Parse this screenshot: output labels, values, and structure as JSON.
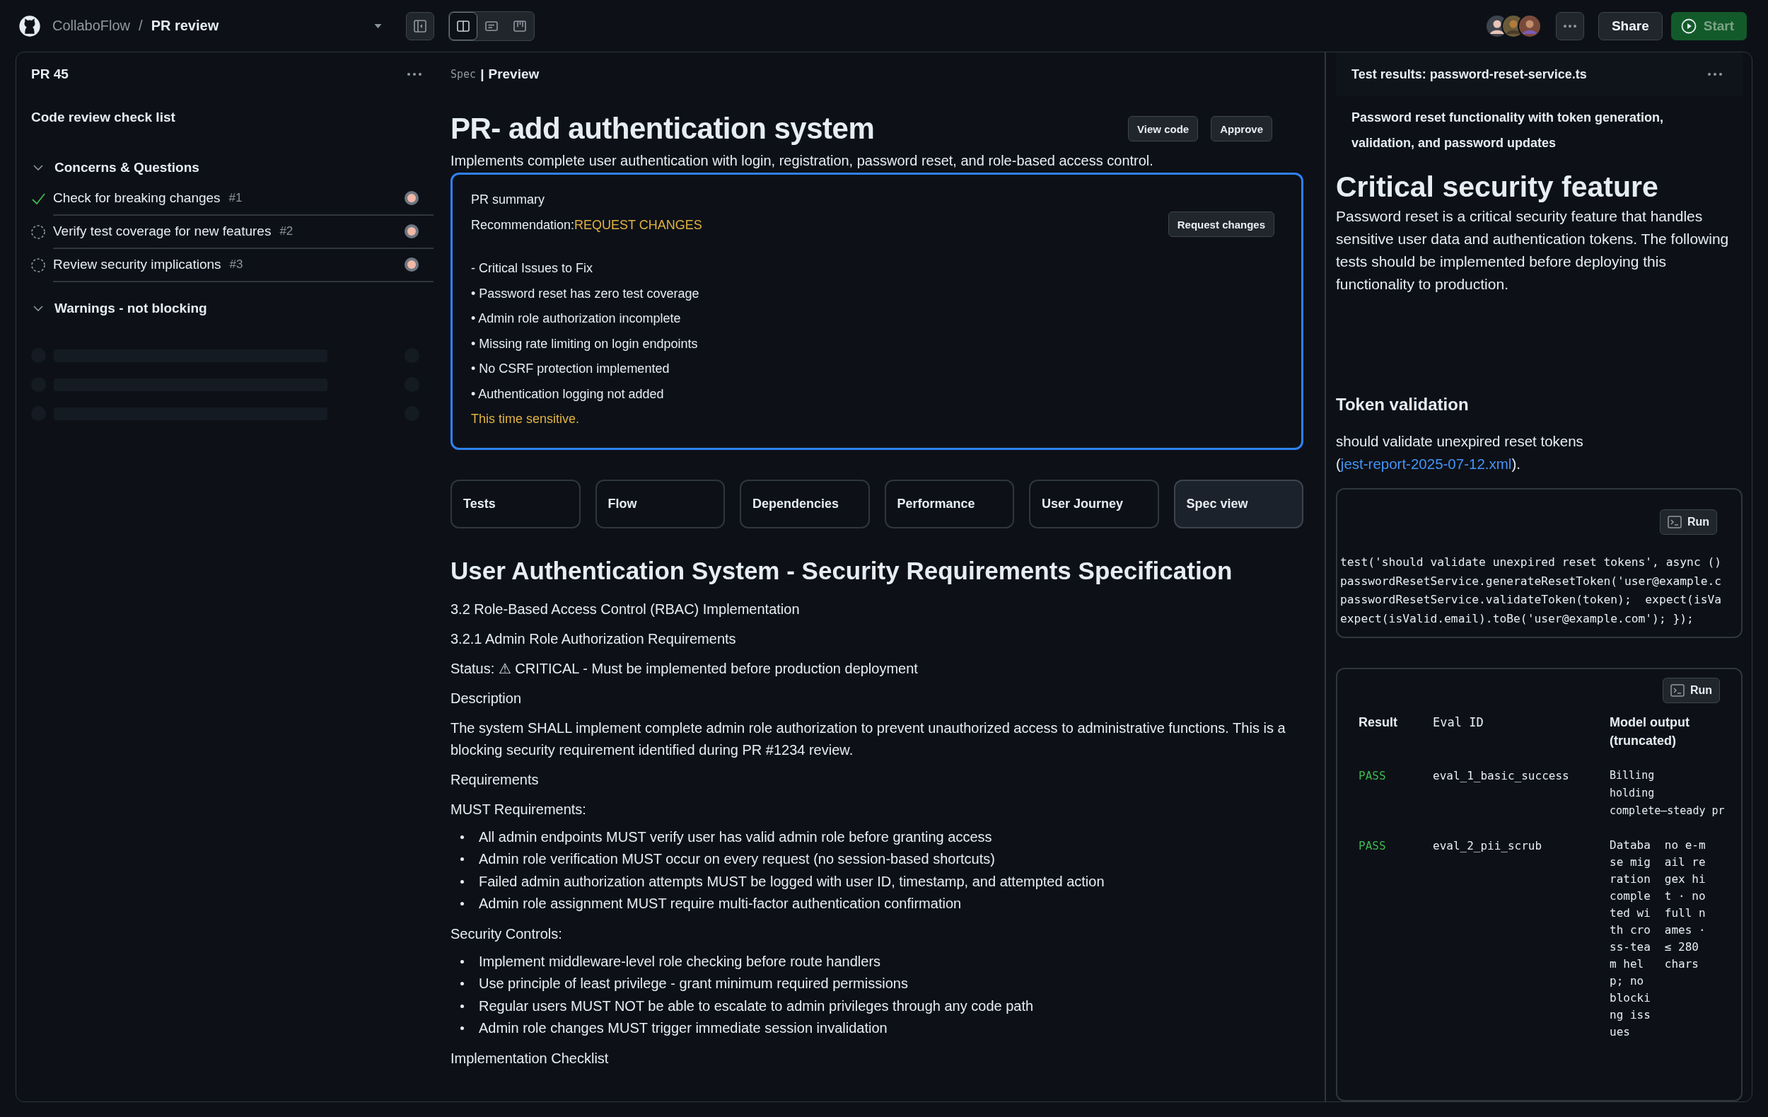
{
  "header": {
    "app": "CollaboFlow",
    "separator": "/",
    "page": "PR review",
    "view_buttons": [
      {
        "selected": true
      },
      {
        "selected": false
      },
      {
        "selected": false
      }
    ],
    "share": "Share",
    "start": "Start"
  },
  "left_panel": {
    "title": "PR 45",
    "heading": "Code review check list",
    "groups": [
      {
        "title": "Concerns & Questions",
        "expanded": true,
        "items": [
          {
            "label": "Check for breaking changes",
            "number": "#1",
            "checked": true
          },
          {
            "label": "Verify test coverage for new features",
            "number": "#2",
            "checked": false
          },
          {
            "label": "Review security implications",
            "number": "#3",
            "checked": false
          }
        ]
      },
      {
        "title": "Warnings - not blocking",
        "expanded": true
      }
    ]
  },
  "preview": {
    "tabs": [
      {
        "label": "Spec",
        "selected": false
      },
      {
        "label": "Preview",
        "selected": true
      }
    ],
    "tab_separator": "|",
    "title": "PR- add authentication system",
    "buttons": [
      "View code",
      "Approve"
    ],
    "description": "Implements complete user authentication with login, registration, password reset, and role-based access control.",
    "summary": {
      "title": "PR summary",
      "recommendation_label": "Recommendation:",
      "recommendation": "REQUEST CHANGES",
      "button": "Request changes",
      "issues_heading": "-  Critical Issues to Fix",
      "issues": [
        "• Password reset has zero test coverage",
        "• Admin role authorization incomplete",
        "• Missing rate limiting on login endpoints",
        "• No CSRF protection implemented",
        "• Authentication logging not added"
      ],
      "note": "This time sensitive."
    },
    "nav_cards": [
      {
        "label": "Tests",
        "selected": false
      },
      {
        "label": "Flow",
        "selected": false
      },
      {
        "label": "Dependencies",
        "selected": false
      },
      {
        "label": "Performance",
        "selected": false
      },
      {
        "label": "User Journey",
        "selected": false
      },
      {
        "label": "Spec view",
        "selected": true
      }
    ],
    "spec": {
      "title": "User Authentication System - Security Requirements Specification",
      "blocks": [
        {
          "kind": "p",
          "text": "3.2 Role-Based Access Control (RBAC) Implementation"
        },
        {
          "kind": "p",
          "text": "3.2.1 Admin Role Authorization Requirements"
        },
        {
          "kind": "p",
          "text": "Status: ⚠ CRITICAL - Must be implemented before production deployment"
        },
        {
          "kind": "p",
          "text": "Description"
        },
        {
          "kind": "p",
          "text": "The system SHALL implement complete admin role authorization to prevent unauthorized access to administrative functions. This is a blocking security requirement identified during PR #1234 review."
        },
        {
          "kind": "p",
          "text": "Requirements"
        },
        {
          "kind": "p",
          "text": "MUST Requirements:"
        },
        {
          "kind": "list",
          "items": [
            "All admin endpoints MUST verify user has valid admin role before granting access",
            "Admin role verification MUST occur on every request (no session-based shortcuts)",
            "Failed admin authorization attempts MUST be logged with user ID, timestamp, and attempted action",
            "Admin role assignment MUST require multi-factor authentication confirmation"
          ]
        },
        {
          "kind": "p",
          "text": "Security Controls:"
        },
        {
          "kind": "list",
          "items": [
            "Implement middleware-level role checking before route handlers",
            "Use principle of least privilege - grant minimum required permissions",
            "Regular users MUST NOT be able to escalate to admin privileges through any code path",
            "Admin role changes MUST trigger immediate session invalidation"
          ]
        },
        {
          "kind": "p",
          "text": "Implementation Checklist"
        }
      ]
    }
  },
  "test_panel": {
    "title": "Test results: password-reset-service.ts",
    "subtitle": "Password reset functionality with token generation, validation, and password updates",
    "heading": "Critical security feature",
    "body": "Password reset is a critical security feature that handles sensitive user data and authentication tokens. The following tests should be implemented before deploying this functionality to production.",
    "section_title": "Token validation",
    "test_text": "should validate unexpired reset tokens (",
    "link": "jest-report-2025-07-12.xml",
    "test_text_end": ").",
    "run_button": "Run",
    "code": [
      "test('should validate unexpired reset tokens', async ()",
      "passwordResetService.generateResetToken('user@example.c",
      "passwordResetService.validateToken(token);  expect(isVa",
      "expect(isValid.email).toBe('user@example.com'); });"
    ],
    "table": {
      "run_button": "Run",
      "columns": [
        {
          "label": "Result",
          "kind": "text"
        },
        {
          "label": "Eval ID",
          "kind": "mono"
        },
        {
          "label": "Model output (truncated)",
          "kind": "text"
        }
      ],
      "rows": [
        {
          "result": "PASS",
          "passed": true,
          "eval_id": "eval_1_basic_success",
          "output": [
            "Billing\nholding\ncomplete—steady pr"
          ]
        },
        {
          "result": "PASS",
          "passed": true,
          "eval_id": "eval_2_pii_scrub",
          "output": [
            "Database migration completed with cross-team help; no blocking issues",
            "no e-mail regex hit · no full names · ≤ 280 chars"
          ]
        }
      ]
    }
  }
}
